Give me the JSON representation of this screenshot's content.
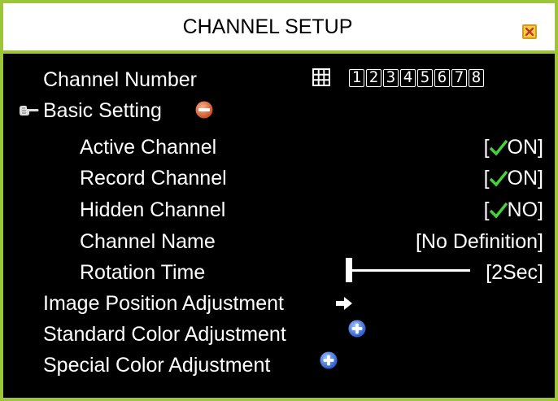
{
  "dialog": {
    "title": "CHANNEL SETUP"
  },
  "channel_number": {
    "label": "Channel Number",
    "channels": [
      "1",
      "2",
      "3",
      "4",
      "5",
      "6",
      "7",
      "8"
    ]
  },
  "basic_setting": {
    "label": "Basic Setting",
    "items": [
      {
        "label": "Active Channel",
        "value_prefix": "[",
        "value": "ON]"
      },
      {
        "label": "Record Channel",
        "value_prefix": "[",
        "value": "ON]"
      },
      {
        "label": "Hidden Channel",
        "value_prefix": "[",
        "value": "NO]"
      },
      {
        "label": "Channel Name",
        "value": "[No Definition]"
      },
      {
        "label": "Rotation Time",
        "value": "[2Sec]",
        "level": 0
      }
    ]
  },
  "sections": {
    "image_position": "Image Position Adjustment",
    "standard_color": "Standard Color Adjustment",
    "special_color": "Special Color Adjustment"
  },
  "colors": {
    "border": "#9cc53a",
    "check": "#44d13a",
    "expand": "#3b6fd9",
    "collapse": "#e06a3a"
  }
}
